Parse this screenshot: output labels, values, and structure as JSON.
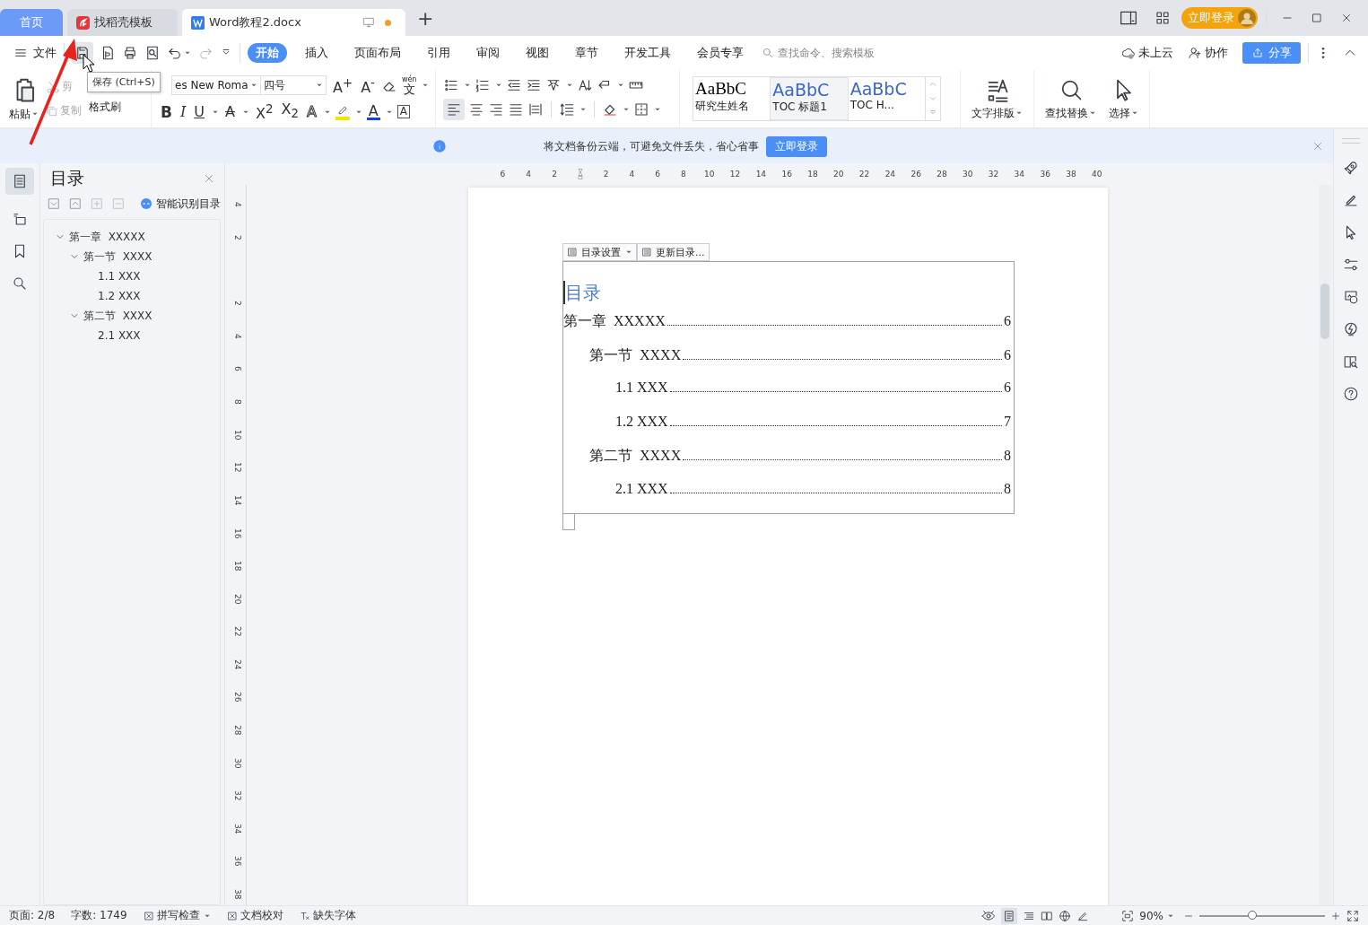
{
  "tabs": [
    {
      "label": "首页",
      "kind": "home",
      "selected": false
    },
    {
      "label": "找稻壳模板",
      "kind": "docer",
      "selected": false
    },
    {
      "label": "Word教程2.docx",
      "kind": "doc",
      "selected": true,
      "unsaved": true
    }
  ],
  "new_tab": "+",
  "login_button": "立即登录",
  "file_menu": "文件",
  "tooltip": "保存 (Ctrl+S)",
  "ribbon_tabs": [
    {
      "label": "开始",
      "selected": true
    },
    {
      "label": "插入",
      "selected": false
    },
    {
      "label": "页面布局",
      "selected": false
    },
    {
      "label": "引用",
      "selected": false
    },
    {
      "label": "审阅",
      "selected": false
    },
    {
      "label": "视图",
      "selected": false
    },
    {
      "label": "章节",
      "selected": false
    },
    {
      "label": "开发工具",
      "selected": false
    },
    {
      "label": "会员专享",
      "selected": false
    }
  ],
  "command_search": {
    "placeholder": "查找命令、搜索模板"
  },
  "cloud_status": "未上云",
  "collaborate": "协作",
  "share": "分享",
  "clipboard": {
    "paste": "粘贴",
    "cut": "剪",
    "copy": "复制",
    "copy_disabled": true,
    "format_painter": "格式刷"
  },
  "font": {
    "name": "es New Roma",
    "size": "四号"
  },
  "font_tools": [
    {
      "label": "A$^{+}$"
    },
    {
      "label": "A$^{-}$"
    }
  ],
  "phonetic_guide": {
    "ruby": "wén",
    "base": "文"
  },
  "format_buttons": [
    {
      "label": "B",
      "kind": "bold"
    },
    {
      "label": "I",
      "kind": "italic"
    },
    {
      "label": "U",
      "kind": "underline"
    },
    {
      "label": "A",
      "kind": "strike"
    },
    {
      "label": "X$^{2}$",
      "kind": "plain"
    },
    {
      "label": "X$_{2}$",
      "kind": "plain"
    },
    {
      "label": "A",
      "kind": "effects"
    },
    {
      "kind": "highlight",
      "color": "#f2e600"
    },
    {
      "label": "A",
      "kind": "color",
      "color": "#1a3cf0"
    },
    {
      "label": "A",
      "kind": "border"
    }
  ],
  "styles": [
    {
      "preview": "AaBbC",
      "label": "研究生姓名",
      "kind": "serif",
      "selected": false
    },
    {
      "preview": "AaBbC",
      "label": "TOC 标题1",
      "kind": "sans",
      "selected": true
    },
    {
      "preview": "AaBbC",
      "label": "TOC H...",
      "kind": "sans",
      "selected": false
    }
  ],
  "big_buttons": [
    "文字排版",
    "查找替换",
    "选择"
  ],
  "notice": {
    "text": "将文档备份云端，可避免文件丢失，省心省事",
    "button": "立即登录"
  },
  "nav": {
    "title": "目录",
    "smart_button": "智能识别目录",
    "tree": [
      {
        "text": "第一章  XXXXX",
        "expanded": true,
        "children": [
          {
            "text": "第一节  XXXX",
            "expanded": true,
            "children": [
              {
                "text": "1.1 XXX"
              },
              {
                "text": "1.2 XXX"
              }
            ]
          },
          {
            "text": "第二节  XXXX",
            "expanded": true,
            "children": [
              {
                "text": "2.1 XXX"
              }
            ]
          }
        ]
      }
    ]
  },
  "hruler": {
    "before": [
      "6",
      "4",
      "2"
    ],
    "after": [
      "2",
      "4",
      "6",
      "8",
      "10",
      "12",
      "14",
      "16",
      "18",
      "20",
      "22",
      "24",
      "26",
      "28",
      "30",
      "32",
      "34",
      "36",
      "38",
      "40"
    ]
  },
  "vruler": {
    "before": [
      "4",
      "2"
    ],
    "after": [
      "2",
      "4",
      "6",
      "8",
      "10",
      "12",
      "14",
      "16",
      "18",
      "20",
      "22",
      "24",
      "26",
      "28",
      "30",
      "32",
      "34",
      "36",
      "38"
    ]
  },
  "document": {
    "toc_toolbar": [
      "目录设置",
      "更新目录..."
    ],
    "toc_title": "目录",
    "toc": [
      {
        "text": "第一章  XXXXX",
        "page": "6",
        "children": [
          {
            "text": "第一节  XXXX",
            "page": "6",
            "children": [
              {
                "text": "1.1 XXX",
                "page": "6"
              },
              {
                "text": "1.2 XXX",
                "page": "7"
              }
            ]
          },
          {
            "text": "第二节  XXXX",
            "page": "8",
            "children": [
              {
                "text": "2.1 XXX",
                "page": "8"
              }
            ]
          }
        ]
      }
    ]
  },
  "status_bar": {
    "page": "页面: 2/8",
    "words": "字数: 1749",
    "spell": "拼写检查",
    "proof": "文档校对",
    "missing_fonts": "缺失字体",
    "zoom": "90%",
    "level": 0.42
  }
}
